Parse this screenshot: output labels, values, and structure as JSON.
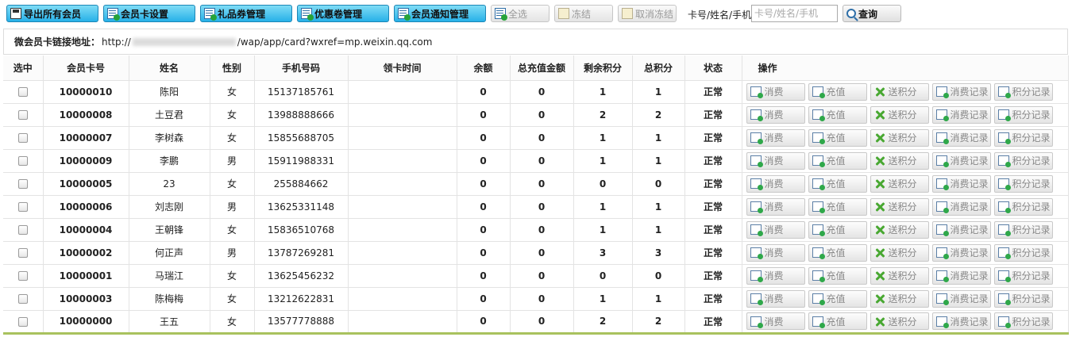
{
  "toolbar": {
    "export_label": "导出所有会员",
    "card_settings_label": "会员卡设置",
    "gift_label": "礼品券管理",
    "coupon_label": "优惠卷管理",
    "notify_label": "会员通知管理",
    "select_all_label": "全选",
    "freeze_label": "冻结",
    "unfreeze_label": "取消冻结",
    "search_label": "卡号/姓名/手机",
    "search_placeholder": "卡号/姓名/手机",
    "query_label": "查询"
  },
  "link": {
    "label": "微会员卡链接地址：",
    "url_prefix": "http://",
    "url_suffix": "/wap/app/card?wxref=mp.weixin.qq.com"
  },
  "table": {
    "headers": [
      "选中",
      "会员卡号",
      "姓名",
      "性别",
      "手机号码",
      "领卡时间",
      "余额",
      "总充值金额",
      "剩余积分",
      "总积分",
      "状态",
      "操作"
    ],
    "rows": [
      {
        "card": "10000010",
        "name": "陈阳",
        "gender": "女",
        "phone": "15137185761",
        "time": "",
        "balance": "0",
        "recharge": "0",
        "points": "1",
        "total": "1",
        "status": "正常"
      },
      {
        "card": "10000008",
        "name": "土豆君",
        "gender": "女",
        "phone": "13988888666",
        "time": "",
        "balance": "0",
        "recharge": "0",
        "points": "2",
        "total": "2",
        "status": "正常"
      },
      {
        "card": "10000007",
        "name": "李树森",
        "gender": "女",
        "phone": "15855688705",
        "time": "",
        "balance": "0",
        "recharge": "0",
        "points": "1",
        "total": "1",
        "status": "正常"
      },
      {
        "card": "10000009",
        "name": "李鹏",
        "gender": "男",
        "phone": "15911988331",
        "time": "",
        "balance": "0",
        "recharge": "0",
        "points": "1",
        "total": "1",
        "status": "正常"
      },
      {
        "card": "10000005",
        "name": "23",
        "gender": "女",
        "phone": "255884662",
        "time": "",
        "balance": "0",
        "recharge": "0",
        "points": "0",
        "total": "0",
        "status": "正常"
      },
      {
        "card": "10000006",
        "name": "刘志刚",
        "gender": "男",
        "phone": "13625331148",
        "time": "",
        "balance": "0",
        "recharge": "0",
        "points": "1",
        "total": "1",
        "status": "正常"
      },
      {
        "card": "10000004",
        "name": "王朝锋",
        "gender": "女",
        "phone": "15836510768",
        "time": "",
        "balance": "0",
        "recharge": "0",
        "points": "1",
        "total": "1",
        "status": "正常"
      },
      {
        "card": "10000002",
        "name": "何正声",
        "gender": "男",
        "phone": "13787269281",
        "time": "",
        "balance": "0",
        "recharge": "0",
        "points": "3",
        "total": "3",
        "status": "正常"
      },
      {
        "card": "10000001",
        "name": "马瑞江",
        "gender": "女",
        "phone": "13625456232",
        "time": "",
        "balance": "0",
        "recharge": "0",
        "points": "0",
        "total": "0",
        "status": "正常"
      },
      {
        "card": "10000003",
        "name": "陈梅梅",
        "gender": "女",
        "phone": "13212622831",
        "time": "",
        "balance": "0",
        "recharge": "0",
        "points": "1",
        "total": "1",
        "status": "正常"
      },
      {
        "card": "10000000",
        "name": "王五",
        "gender": "女",
        "phone": "13577778888",
        "time": "",
        "balance": "0",
        "recharge": "0",
        "points": "2",
        "total": "2",
        "status": "正常"
      }
    ],
    "actions": [
      {
        "key": "consume",
        "label": "消费",
        "icon": "consume-icon"
      },
      {
        "key": "recharge",
        "label": "充值",
        "icon": "recharge-icon"
      },
      {
        "key": "give-points",
        "label": "送积分",
        "icon": "give-points-icon"
      },
      {
        "key": "consume-log",
        "label": "消费记录",
        "icon": "consume-log-icon"
      },
      {
        "key": "points-log",
        "label": "积分记录",
        "icon": "points-log-icon"
      }
    ]
  }
}
